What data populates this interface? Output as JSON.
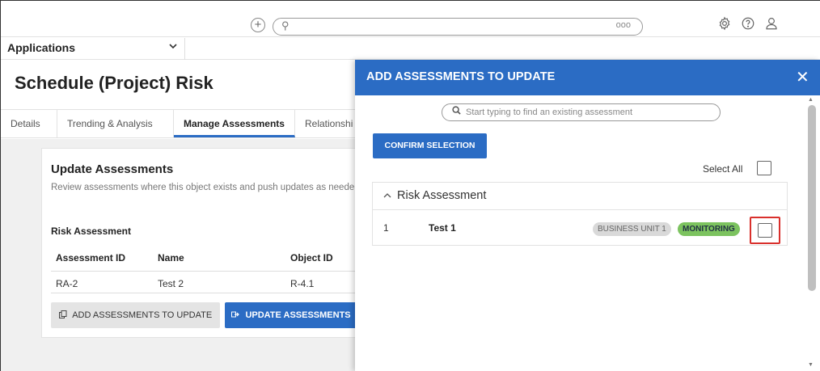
{
  "topbar": {
    "add_icon": "plus-circle",
    "search_icon": "magnifier",
    "more_label": "ooo",
    "settings_icon": "gear",
    "help_icon": "question-circle",
    "user_icon": "user-outline"
  },
  "appbar": {
    "label": "Applications",
    "chevron": "⌄"
  },
  "page": {
    "title": "Schedule (Project) Risk"
  },
  "tabs": [
    {
      "label": "Details"
    },
    {
      "label": "Trending & Analysis"
    },
    {
      "label": "Manage Assessments"
    },
    {
      "label": "Relationshi"
    }
  ],
  "card": {
    "title": "Update Assessments",
    "subtitle": "Review assessments where this object exists and push updates as neede",
    "section": "Risk Assessment",
    "columns": [
      "Assessment ID",
      "Name",
      "Object ID"
    ],
    "rows": [
      {
        "id": "RA-2",
        "name": "Test 2",
        "object_id": "R-4.1"
      }
    ],
    "btn_add": "ADD ASSESSMENTS TO UPDATE",
    "btn_update": "UPDATE ASSESSMENTS"
  },
  "drawer": {
    "title": "ADD ASSESSMENTS TO UPDATE",
    "close": "✕",
    "search_placeholder": "Start typing to find an existing assessment",
    "confirm": "CONFIRM SELECTION",
    "select_all": "Select All",
    "group": {
      "caret": "^",
      "title": "Risk Assessment",
      "items": [
        {
          "number": "1",
          "name": "Test 1",
          "badge_unit": "BUSINESS UNIT 1",
          "badge_status": "MONITORING",
          "checked": false
        }
      ]
    }
  },
  "colors": {
    "accent": "#2b6cc4",
    "monitoring": "#7cc35f",
    "highlight": "#d9302c"
  }
}
